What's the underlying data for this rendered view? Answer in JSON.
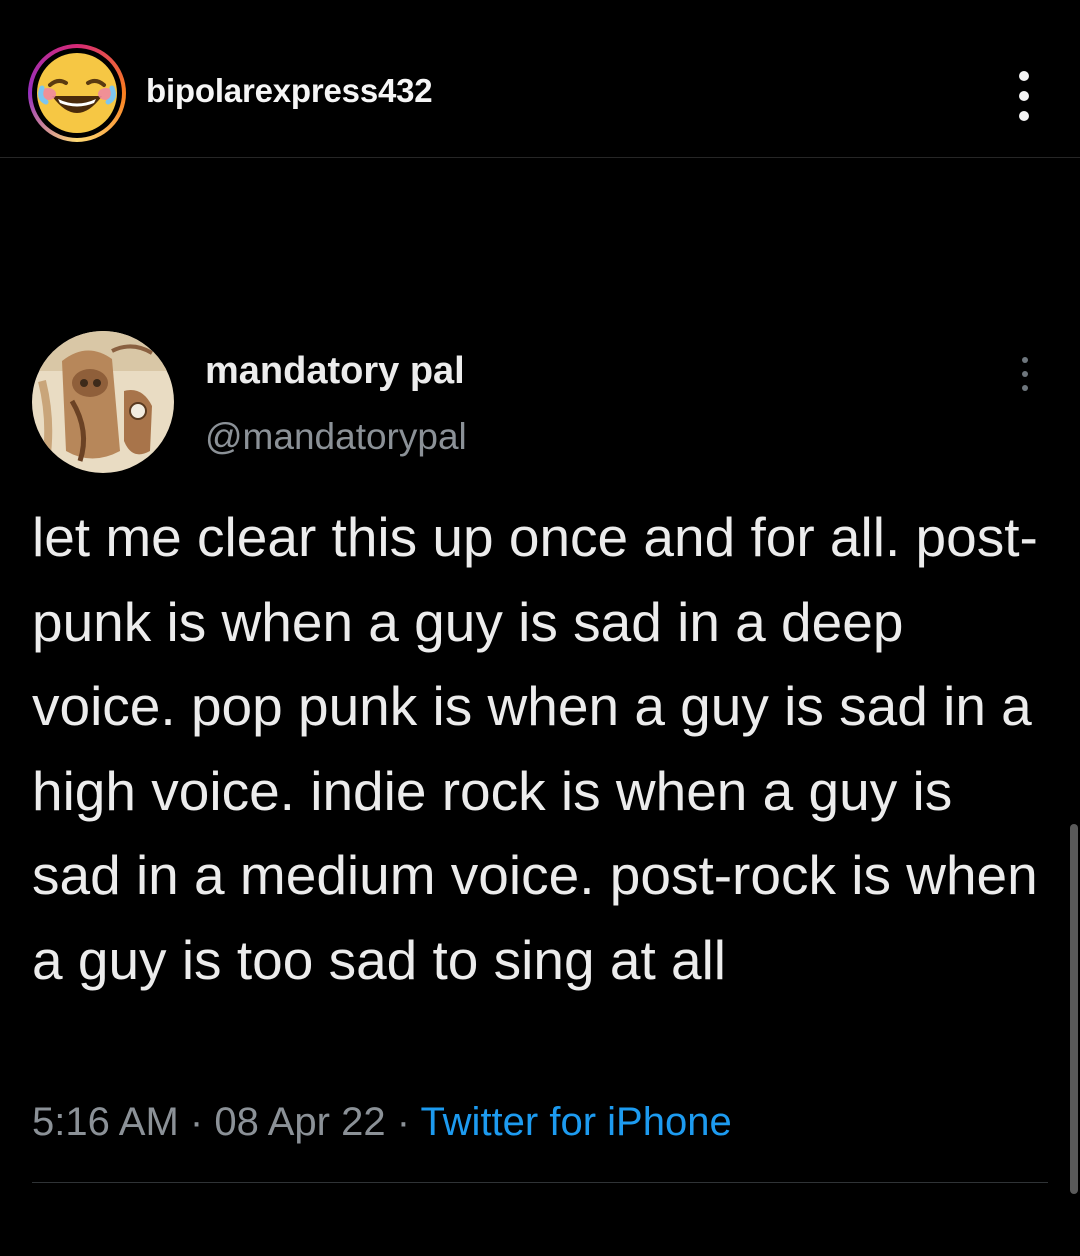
{
  "post": {
    "username": "bipolarexpress432",
    "avatar_icon": "laughing-tears-emoji-icon",
    "more_icon": "vertical-ellipsis-icon"
  },
  "tweet": {
    "display_name": "mandatory pal",
    "handle": "@mandatorypal",
    "avatar_icon": "painting-avatar-icon",
    "text": "let me clear this up once and for all. post-punk is when a guy is sad in a deep voice. pop punk is when a guy is sad in a high voice. indie rock is when a guy is sad in a medium voice. post-rock is when a guy is too sad to sing at all",
    "time": "5:16 AM",
    "date": "08 Apr 22",
    "separator": "·",
    "source": "Twitter for iPhone"
  },
  "colors": {
    "background": "#000000",
    "text": "#ececec",
    "muted": "#8b9197",
    "link": "#1d9bf0"
  }
}
